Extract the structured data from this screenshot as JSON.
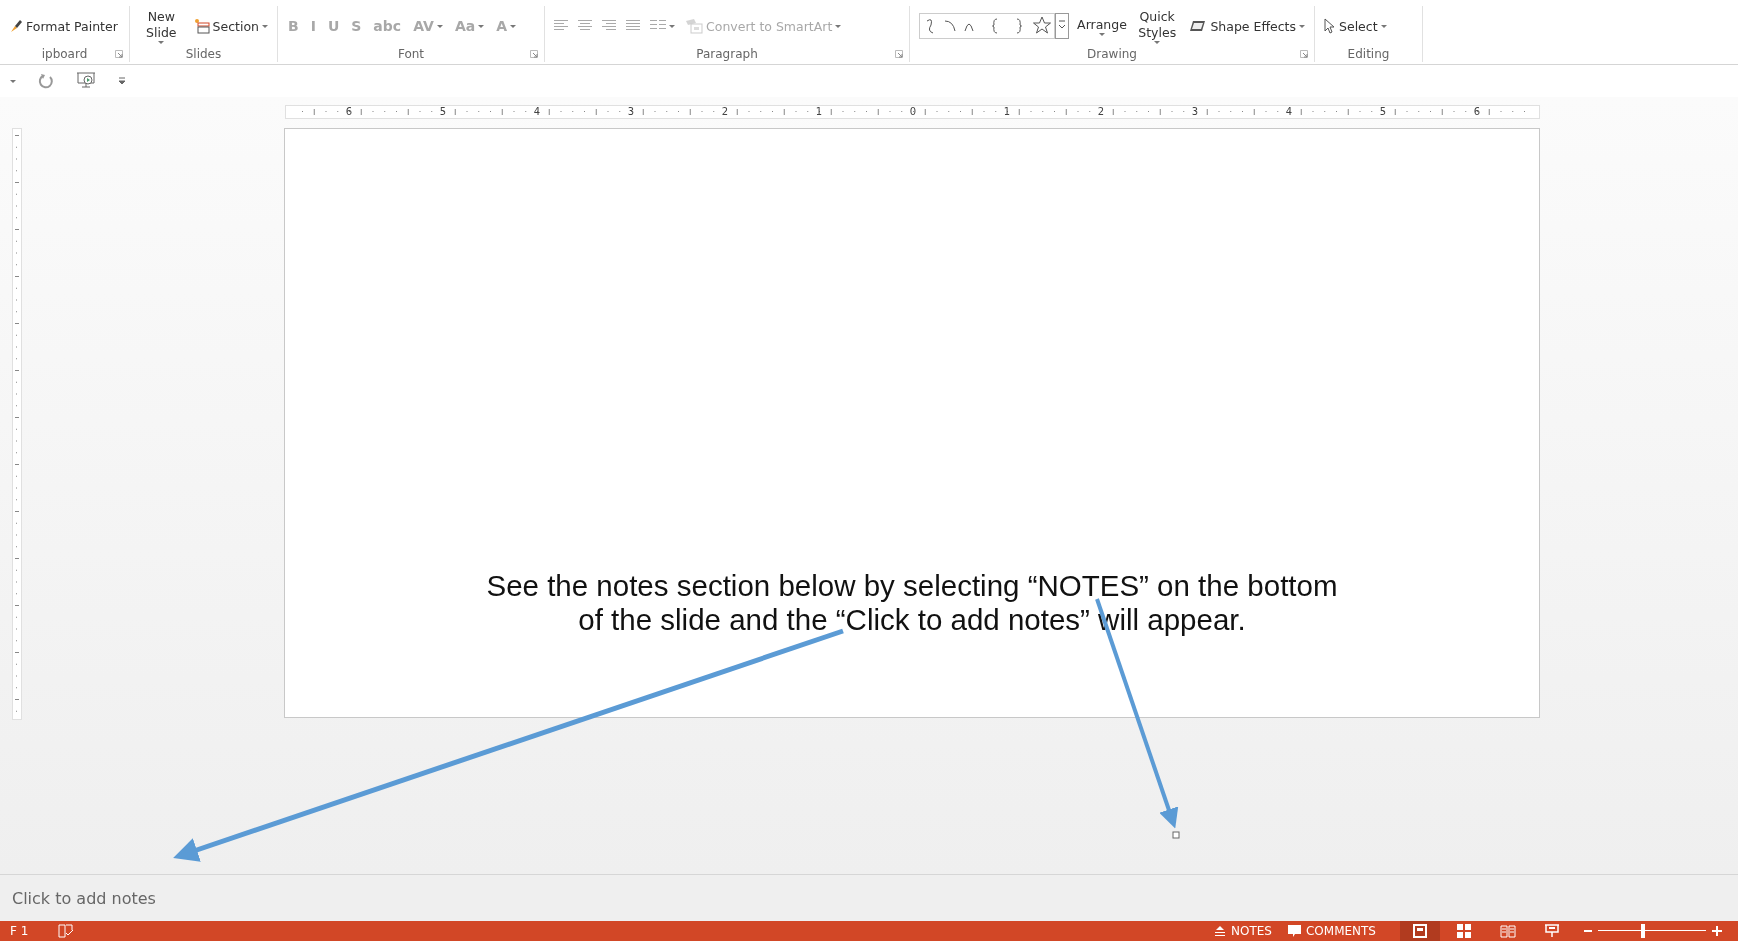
{
  "ribbon": {
    "groups": [
      {
        "label": "ipboard",
        "items": [
          {
            "kind": "brush",
            "label": "Format Painter",
            "dropdown": false,
            "disabled": false
          }
        ]
      },
      {
        "label": "Slides",
        "items": [
          {
            "kind": "large",
            "label": "New Slide",
            "dropdown": true,
            "disabled": false
          },
          {
            "kind": "section",
            "label": "Section",
            "dropdown": true,
            "disabled": false
          }
        ]
      },
      {
        "label": "Font",
        "items": [
          {
            "kind": "glyph",
            "label": "B",
            "dropdown": false,
            "disabled": true
          },
          {
            "kind": "glyph",
            "label": "I",
            "dropdown": false,
            "disabled": true
          },
          {
            "kind": "glyph",
            "label": "U",
            "dropdown": false,
            "disabled": true
          },
          {
            "kind": "glyph",
            "label": "S",
            "dropdown": false,
            "disabled": true
          },
          {
            "kind": "glyph",
            "label": "abc",
            "dropdown": false,
            "disabled": true
          },
          {
            "kind": "glyph",
            "label": "AV",
            "dropdown": true,
            "disabled": true
          },
          {
            "kind": "glyph",
            "label": "Aa",
            "dropdown": true,
            "disabled": true
          },
          {
            "kind": "glyph",
            "label": "A",
            "dropdown": true,
            "disabled": true
          }
        ]
      },
      {
        "label": "Paragraph",
        "items": [
          {
            "kind": "alignleft",
            "dropdown": false,
            "disabled": true
          },
          {
            "kind": "aligncenter",
            "dropdown": false,
            "disabled": true
          },
          {
            "kind": "alignright",
            "dropdown": false,
            "disabled": true
          },
          {
            "kind": "justify",
            "dropdown": false,
            "disabled": true
          },
          {
            "kind": "columns",
            "dropdown": true,
            "disabled": true
          },
          {
            "kind": "smartart",
            "label": "Convert to SmartArt",
            "dropdown": true,
            "disabled": true
          }
        ]
      },
      {
        "label": "Drawing",
        "items": [
          {
            "kind": "shapes",
            "dropdown": false,
            "disabled": false
          },
          {
            "kind": "large",
            "label": "Arrange",
            "dropdown": true,
            "disabled": false
          },
          {
            "kind": "large",
            "label": "Quick Styles",
            "dropdown": true,
            "disabled": false
          },
          {
            "kind": "effects",
            "label": "Shape Effects",
            "dropdown": true,
            "disabled": false
          }
        ]
      },
      {
        "label": "Editing",
        "items": [
          {
            "kind": "select",
            "label": "Select",
            "dropdown": true,
            "disabled": false
          }
        ]
      }
    ]
  },
  "ruler": {
    "labels": [
      "6",
      "5",
      "4",
      "3",
      "2",
      "1",
      "0",
      "1",
      "2",
      "3",
      "4",
      "5",
      "6"
    ]
  },
  "slide": {
    "lines": [
      "See the notes section below by selecting “NOTES” on the bottom",
      "of the slide and the “Click to add notes” will appear."
    ]
  },
  "notes": {
    "placeholder": "Click to add notes"
  },
  "status_bar": {
    "slide_indicator": "F 1",
    "notes": "NOTES",
    "comments": "COMMENTS",
    "views": [
      {
        "kind": "normal",
        "selected": true
      },
      {
        "kind": "sorter",
        "selected": false
      },
      {
        "kind": "reading",
        "selected": false
      },
      {
        "kind": "slideshow",
        "selected": false
      }
    ],
    "zoom": {
      "level": 0.42
    }
  }
}
